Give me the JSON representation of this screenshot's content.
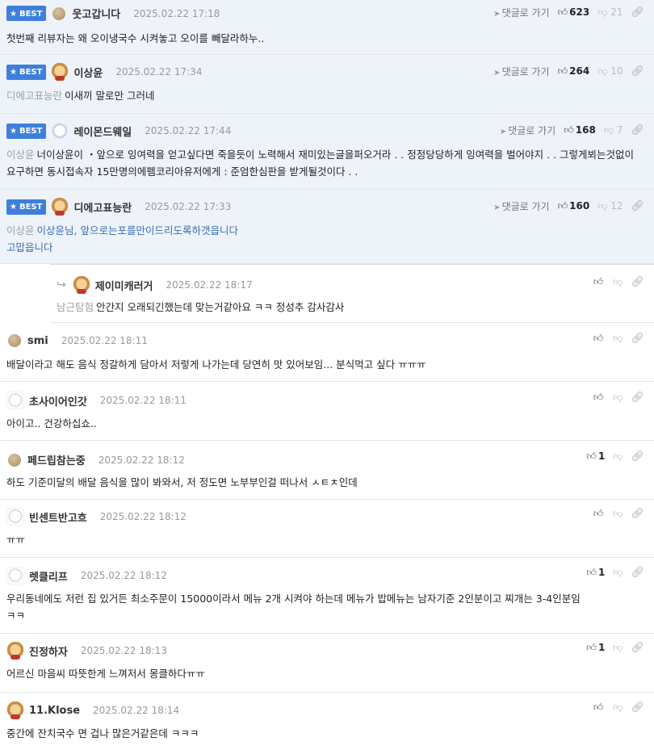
{
  "ui": {
    "best_label": "BEST",
    "goto_label": "댓글로 가기"
  },
  "comments": [
    {
      "best": true,
      "nick": "웃고갑니다",
      "date": "2025.02.22 17:18",
      "up": "623",
      "down": "21",
      "mention": "",
      "text": "첫번째 리뷰자는 왜 오이냉국수 시켜놓고 오이를 빼달라하누..",
      "avatar": "ball-icon"
    },
    {
      "best": true,
      "nick": "이상윤",
      "date": "2025.02.22 17:34",
      "up": "264",
      "down": "10",
      "mention": "디에고표능란",
      "text": "이새끼 말로만 그러네",
      "avatar": "puppy-avatar-icon"
    },
    {
      "best": true,
      "nick": "레이몬드웨일",
      "date": "2025.02.22 17:44",
      "up": "168",
      "down": "7",
      "mention": "이상윤",
      "text": "너이상윤이 ・앞으로 잉여력을 얻고싶다면 죽을듯이 노력해서 재미있는글을퍼오거라 . . 정정당당하게 잉여력을 벌어야지 . . 그렇게뵈는것없이 요구하면 동시접속자 15만명의에펨코리아유저에게 : 준엄한심판을 받게될것이다 . .",
      "avatar": "polar-bear-avatar-icon"
    },
    {
      "best": true,
      "nick": "디에고표능란",
      "date": "2025.02.22 17:33",
      "up": "160",
      "down": "12",
      "mention": "이상윤",
      "text": "이상윤님, 앞으로는포를만이드리도록하갯읍니다",
      "text2": "고맙읍니다",
      "avatar": "puppy-avatar-icon"
    },
    {
      "reply": true,
      "nick": "제이미캐러거",
      "date": "2025.02.22 18:17",
      "up": "",
      "mention": "남근탐험",
      "text": "안간지 오래되긴했는데 맞는거같아요 ㅋㅋ 정성추 감사감사",
      "avatar": "puppy-avatar-icon"
    },
    {
      "nick": "smi",
      "date": "2025.02.22 18:11",
      "up": "",
      "mention": "",
      "text": "배달이라고 해도 음식 정갈하게 담아서 저렇게 나가는데 당연히 맛 있어보임... 분식먹고 싶다 ㅠㅠㅠ",
      "avatar": "ball-icon"
    },
    {
      "nick": "초사이어인갓",
      "date": "2025.02.22 18:11",
      "up": "",
      "mention": "",
      "text": "아이고.. 건강하십쇼..",
      "avatar": "white-dog-avatar-icon"
    },
    {
      "nick": "페드립참는중",
      "date": "2025.02.22 18:12",
      "up": "1",
      "mention": "",
      "text": "하도 기준미달의 배달 음식을 많이 봐와서, 저 정도면 노부부인걸 떠나서 ㅅㅌㅊ인데",
      "avatar": "ball-icon"
    },
    {
      "nick": "빈센트반고흐",
      "date": "2025.02.22 18:12",
      "up": "",
      "mention": "",
      "text": "ㅠㅠ",
      "avatar": "white-dog-avatar-icon"
    },
    {
      "nick": "렛클리프",
      "date": "2025.02.22 18:12",
      "up": "1",
      "mention": "",
      "text": "우리동네에도 저런 집 있거든 최소주문이 15000이라서 메뉴 2개 시켜야 하는데 메뉴가 밥메뉴는 남자기준 2인분이고 찌개는 3-4인분임",
      "text2": "ㅋㅋ",
      "avatar": "white-dog-avatar-icon"
    },
    {
      "nick": "진정하자",
      "date": "2025.02.22 18:13",
      "up": "1",
      "mention": "",
      "text": "어르신 마음씨 따뜻한게 느껴저서 몽클하다ㅠㅠ",
      "avatar": "puppy-avatar-icon"
    },
    {
      "nick": "11.Klose",
      "date": "2025.02.22 18:14",
      "up": "",
      "mention": "",
      "text": "중간에 잔치국수 면 겁나 많은거같은데 ㅋㅋㅋ",
      "avatar": "puppy-avatar-icon"
    }
  ]
}
